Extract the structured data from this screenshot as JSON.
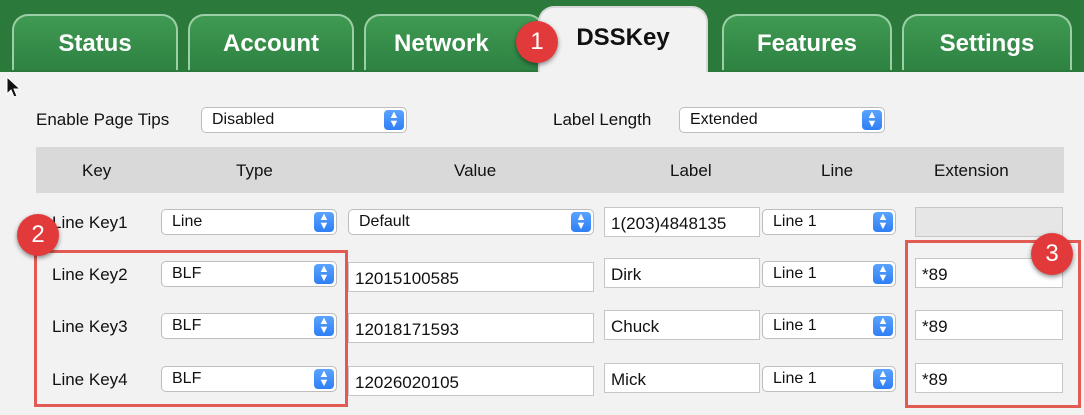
{
  "tabs": [
    {
      "label": "Status"
    },
    {
      "label": "Account"
    },
    {
      "label": "Network"
    },
    {
      "label": "DSSKey",
      "active": true
    },
    {
      "label": "Features"
    },
    {
      "label": "Settings"
    }
  ],
  "callouts": {
    "one": "1",
    "two": "2",
    "three": "3"
  },
  "options": {
    "page_tips_label": "Enable Page Tips",
    "page_tips_value": "Disabled",
    "label_length_label": "Label Length",
    "label_length_value": "Extended"
  },
  "table": {
    "headers": [
      "Key",
      "Type",
      "Value",
      "Label",
      "Line",
      "Extension"
    ],
    "rows": [
      {
        "key": "Line Key1",
        "type": "Line",
        "value": "Default",
        "label": "1(203)4848135",
        "line": "Line 1",
        "extension": ""
      },
      {
        "key": "Line Key2",
        "type": "BLF",
        "value": "12015100585",
        "label": "Dirk",
        "line": "Line 1",
        "extension": "*89"
      },
      {
        "key": "Line Key3",
        "type": "BLF",
        "value": "12018171593",
        "label": "Chuck",
        "line": "Line 1",
        "extension": "*89"
      },
      {
        "key": "Line Key4",
        "type": "BLF",
        "value": "12026020105",
        "label": "Mick",
        "line": "Line 1",
        "extension": "*89"
      }
    ]
  },
  "colors": {
    "tab_green": "#2e8242",
    "highlight_red": "#e25a54",
    "callout_red": "#e23a3a",
    "select_arrow_blue": "#2f7ff5"
  }
}
